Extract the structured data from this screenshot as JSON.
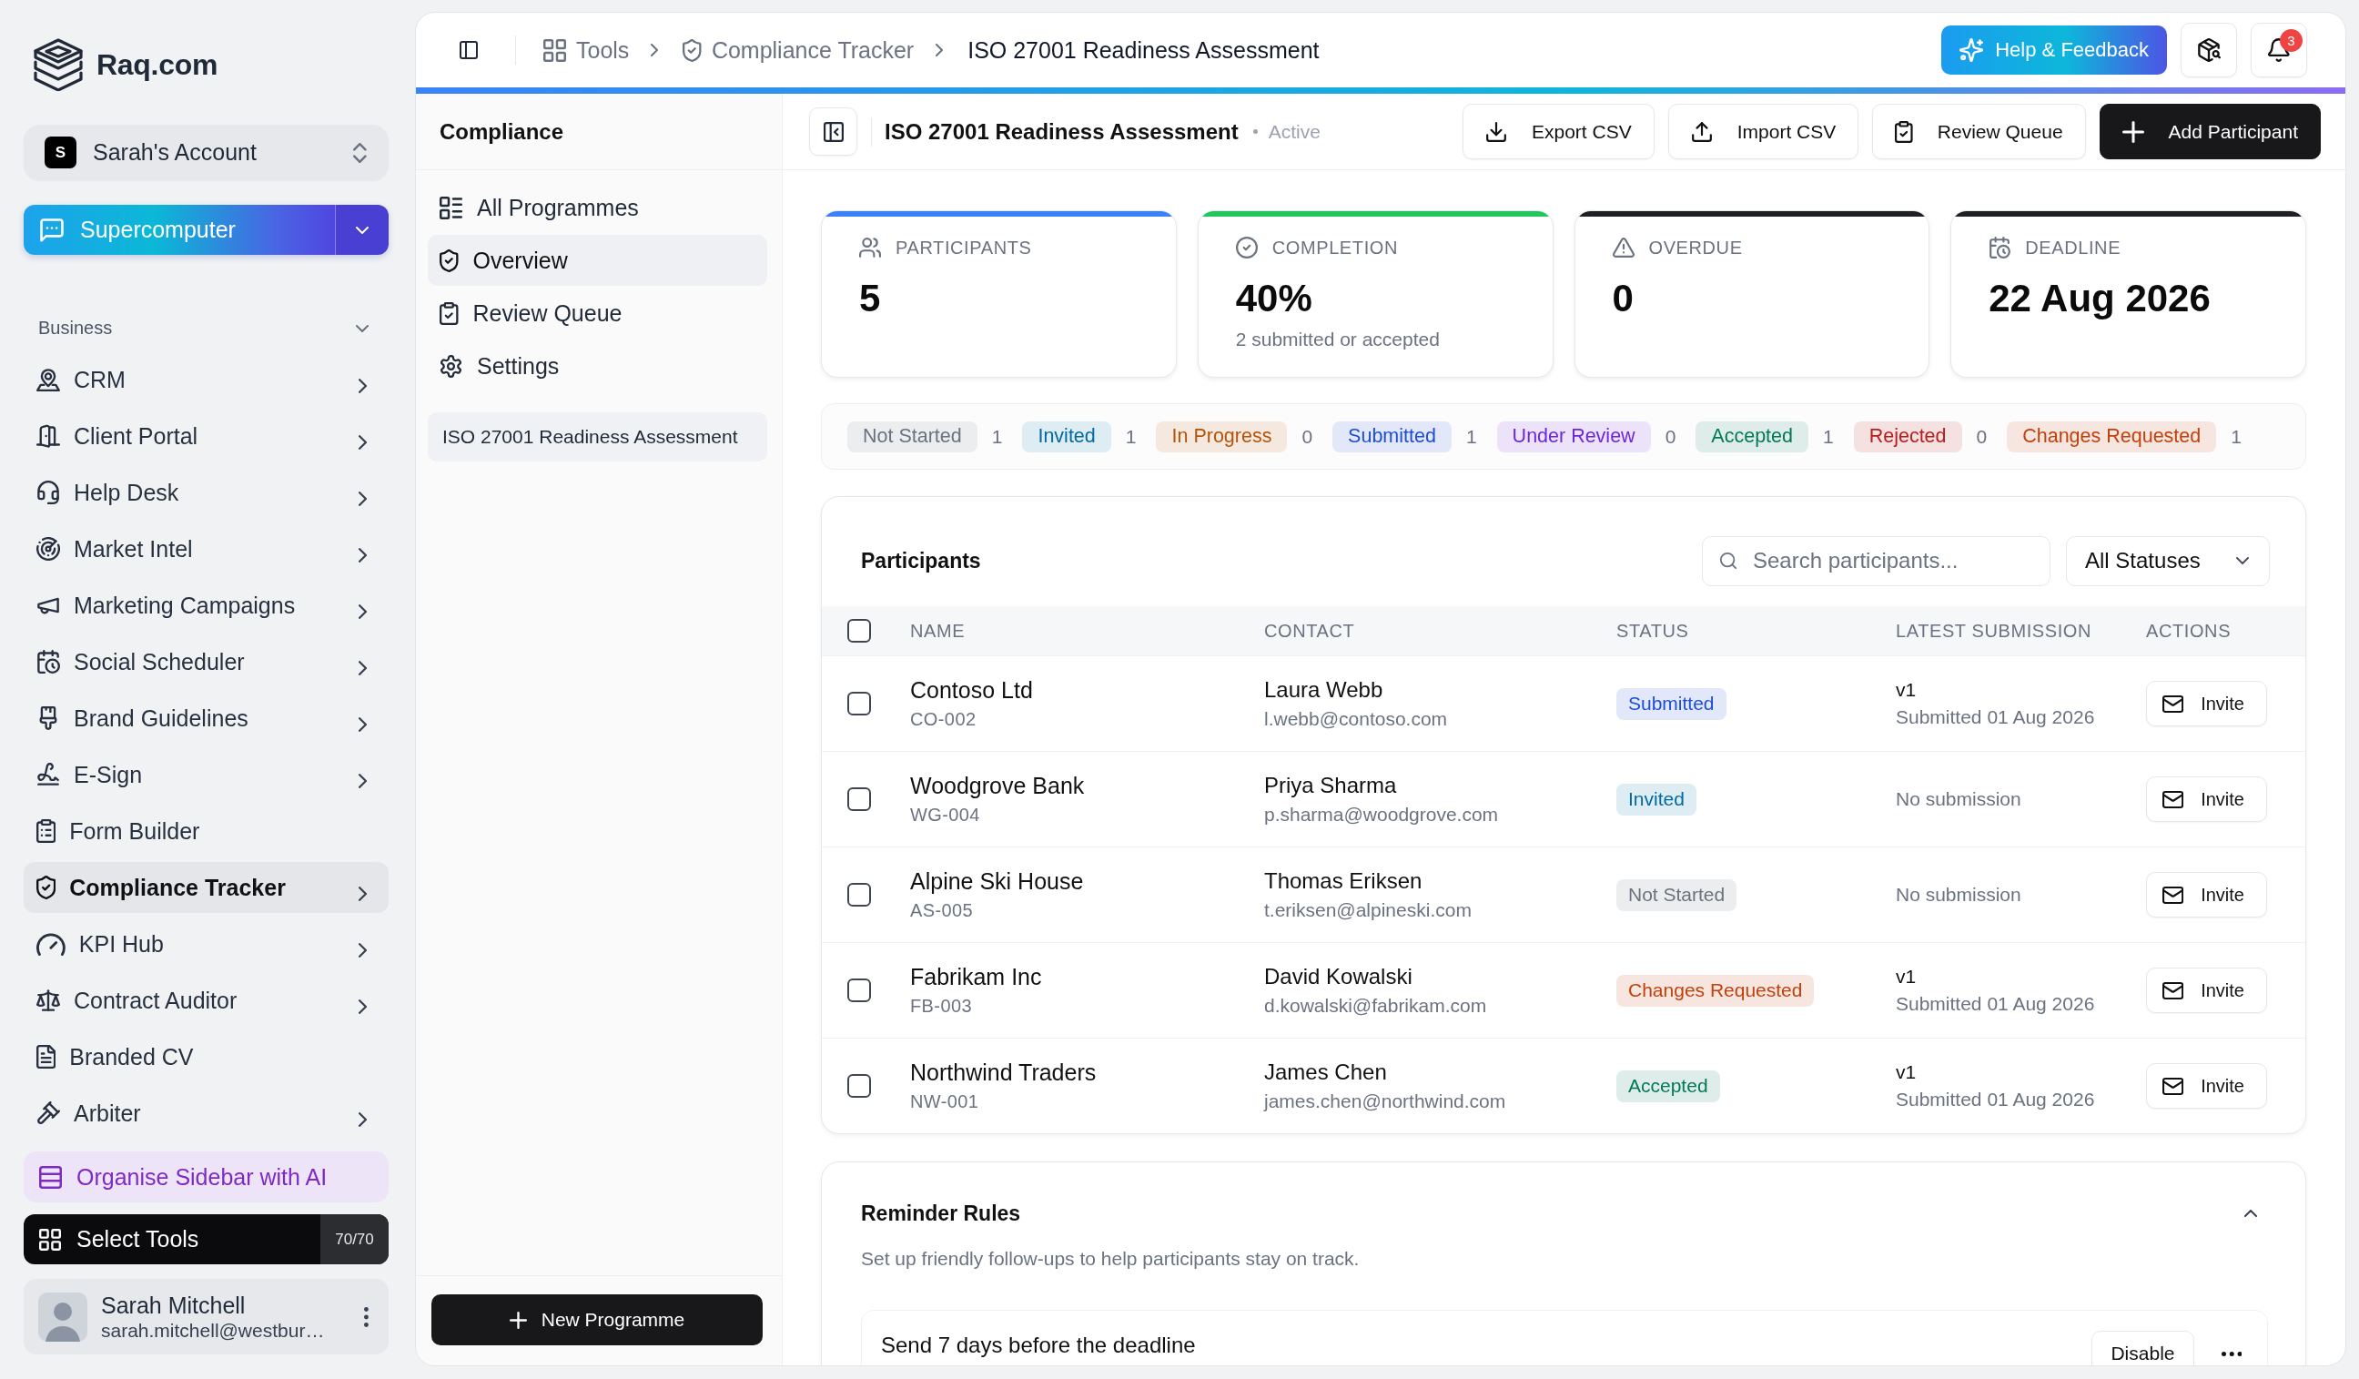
{
  "sidebar": {
    "logo": "Raq.com",
    "account": {
      "initial": "S",
      "name": "Sarah's Account"
    },
    "assistant": {
      "label": "Supercomputer"
    },
    "section": {
      "label": "Business",
      "expanded": true
    },
    "items": [
      {
        "label": "CRM",
        "has_submenu": true,
        "selected": false
      },
      {
        "label": "Client Portal",
        "has_submenu": true,
        "selected": false
      },
      {
        "label": "Help Desk",
        "has_submenu": true,
        "selected": false
      },
      {
        "label": "Market Intel",
        "has_submenu": true,
        "selected": false
      },
      {
        "label": "Marketing Campaigns",
        "has_submenu": true,
        "selected": false
      },
      {
        "label": "Social Scheduler",
        "has_submenu": true,
        "selected": false
      },
      {
        "label": "Brand Guidelines",
        "has_submenu": true,
        "selected": false
      },
      {
        "label": "E-Sign",
        "has_submenu": true,
        "selected": false
      },
      {
        "label": "Form Builder",
        "has_submenu": false,
        "selected": false
      },
      {
        "label": "Compliance Tracker",
        "has_submenu": true,
        "selected": true
      },
      {
        "label": "KPI Hub",
        "has_submenu": true,
        "selected": false
      },
      {
        "label": "Contract Auditor",
        "has_submenu": true,
        "selected": false
      },
      {
        "label": "Branded CV",
        "has_submenu": false,
        "selected": false
      },
      {
        "label": "Arbiter",
        "has_submenu": true,
        "selected": false
      }
    ],
    "organise": {
      "label": "Organise Sidebar with AI"
    },
    "select_tools": {
      "label": "Select Tools",
      "count": "70/70"
    },
    "user": {
      "name": "Sarah Mitchell",
      "email": "sarah.mitchell@westbur…"
    }
  },
  "topbar": {
    "breadcrumbs": [
      {
        "label": "Tools",
        "current": false
      },
      {
        "label": "Compliance Tracker",
        "current": false
      },
      {
        "label": "ISO 27001 Readiness Assessment",
        "current": true
      }
    ],
    "help": {
      "label": "Help & Feedback"
    },
    "notifications": {
      "count": "3"
    }
  },
  "panel": {
    "title": "Compliance",
    "nav": [
      {
        "label": "All Programmes",
        "selected": false
      },
      {
        "label": "Overview",
        "selected": true
      },
      {
        "label": "Review Queue",
        "selected": false
      },
      {
        "label": "Settings",
        "selected": false
      }
    ],
    "programmes": [
      {
        "label": "ISO 27001 Readiness Assessment"
      }
    ],
    "new_button": {
      "label": "New Programme"
    }
  },
  "header": {
    "title": "ISO 27001 Readiness Assessment",
    "status": "Active",
    "actions": [
      {
        "label": "Export CSV",
        "kind": "outline"
      },
      {
        "label": "Import CSV",
        "kind": "outline"
      },
      {
        "label": "Review Queue",
        "kind": "outline"
      },
      {
        "label": "Add Participant",
        "kind": "primary"
      }
    ]
  },
  "stats": [
    {
      "label": "PARTICIPANTS",
      "value": "5",
      "color": "#3b82f6"
    },
    {
      "label": "COMPLETION",
      "value": "40%",
      "note": "2 submitted or accepted",
      "color": "#22c55e"
    },
    {
      "label": "OVERDUE",
      "value": "0",
      "color": "#1f2023"
    },
    {
      "label": "DEADLINE",
      "value": "22 Aug 2026",
      "color": "#1f2023"
    }
  ],
  "status_counts": [
    {
      "label": "Not Started",
      "count": "1",
      "color": "#6b7280"
    },
    {
      "label": "Invited",
      "count": "1",
      "color": "#0369a1"
    },
    {
      "label": "In Progress",
      "count": "0",
      "color": "#b45309"
    },
    {
      "label": "Submitted",
      "count": "1",
      "color": "#1d4ed8"
    },
    {
      "label": "Under Review",
      "count": "0",
      "color": "#6d28d9"
    },
    {
      "label": "Accepted",
      "count": "1",
      "color": "#047857"
    },
    {
      "label": "Rejected",
      "count": "0",
      "color": "#b91c1c"
    },
    {
      "label": "Changes Requested",
      "count": "1",
      "color": "#c2410c"
    }
  ],
  "participants": {
    "title": "Participants",
    "search": {
      "placeholder": "Search participants..."
    },
    "filter": {
      "label": "All Statuses"
    },
    "select_all": {
      "checked": false
    },
    "columns": [
      "NAME",
      "CONTACT",
      "STATUS",
      "LATEST SUBMISSION",
      "ACTIONS"
    ],
    "rows": [
      {
        "checked": false,
        "name": "Contoso Ltd",
        "code": "CO-002",
        "contact": "Laura Webb",
        "email": "l.webb@contoso.com",
        "status": {
          "label": "Submitted",
          "color": "#1d4ed8"
        },
        "submission": {
          "version": "v1",
          "text": "Submitted 01 Aug 2026"
        },
        "action": "Invite"
      },
      {
        "checked": false,
        "name": "Woodgrove Bank",
        "code": "WG-004",
        "contact": "Priya Sharma",
        "email": "p.sharma@woodgrove.com",
        "status": {
          "label": "Invited",
          "color": "#0369a1"
        },
        "submission": {
          "text": "No submission"
        },
        "action": "Invite"
      },
      {
        "checked": false,
        "name": "Alpine Ski House",
        "code": "AS-005",
        "contact": "Thomas Eriksen",
        "email": "t.eriksen@alpineski.com",
        "status": {
          "label": "Not Started",
          "color": "#6b7280"
        },
        "submission": {
          "text": "No submission"
        },
        "action": "Invite"
      },
      {
        "checked": false,
        "name": "Fabrikam Inc",
        "code": "FB-003",
        "contact": "David Kowalski",
        "email": "d.kowalski@fabrikam.com",
        "status": {
          "label": "Changes Requested",
          "color": "#c2410c"
        },
        "submission": {
          "version": "v1",
          "text": "Submitted 01 Aug 2026"
        },
        "action": "Invite"
      },
      {
        "checked": false,
        "name": "Northwind Traders",
        "code": "NW-001",
        "contact": "James Chen",
        "email": "james.chen@northwind.com",
        "status": {
          "label": "Accepted",
          "color": "#047857"
        },
        "submission": {
          "version": "v1",
          "text": "Submitted 01 Aug 2026"
        },
        "action": "Invite"
      }
    ]
  },
  "reminders": {
    "title": "Reminder Rules",
    "expanded": true,
    "description": "Set up friendly follow-ups to help participants stay on track.",
    "rules": [
      {
        "label": "Send 7 days before the deadline",
        "action": "Disable"
      }
    ]
  }
}
